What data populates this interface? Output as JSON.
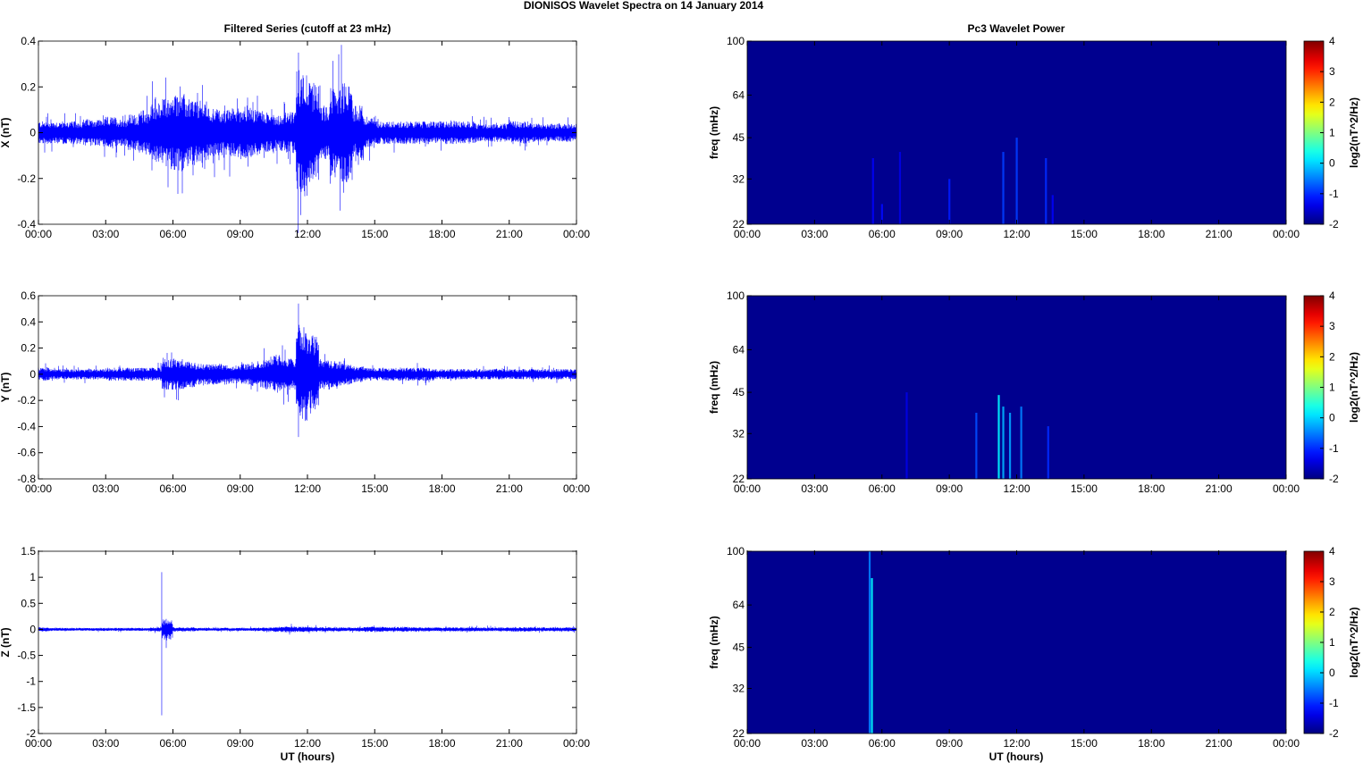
{
  "title": "DIONISOS Wavelet Spectra on 14 January   2014",
  "left_title": "Filtered Series (cutoff at 23 mHz)",
  "right_title": "Pc3 Wavelet Power",
  "xlabel": "UT (hours)",
  "xticks": [
    "00:00",
    "03:00",
    "06:00",
    "09:00",
    "12:00",
    "15:00",
    "18:00",
    "21:00",
    "00:00"
  ],
  "colors": {
    "trace": "#0000ff",
    "bg": "#00008f"
  },
  "chart_data": [
    {
      "type": "line",
      "component": "X",
      "ylabel": "X (nT)",
      "ylim": [
        -0.4,
        0.4
      ],
      "yticks": [
        "0.4",
        "0.2",
        "0",
        "-0.2",
        "-0.4"
      ],
      "ytick_values": [
        0.4,
        0.2,
        0,
        -0.2,
        -0.4
      ],
      "xlim_hours": [
        0,
        24
      ],
      "envelope_halfhourly": [
        0.05,
        0.05,
        0.05,
        0.05,
        0.06,
        0.06,
        0.07,
        0.06,
        0.08,
        0.1,
        0.13,
        0.15,
        0.17,
        0.15,
        0.14,
        0.11,
        0.1,
        0.11,
        0.12,
        0.1,
        0.09,
        0.08,
        0.09,
        0.28,
        0.22,
        0.12,
        0.2,
        0.22,
        0.12,
        0.07,
        0.05,
        0.05,
        0.05,
        0.05,
        0.05,
        0.05,
        0.05,
        0.05,
        0.05,
        0.04,
        0.04,
        0.04,
        0.05,
        0.05,
        0.04,
        0.04,
        0.04,
        0.04
      ],
      "extremes": {
        "max": 0.35,
        "max_time_h": 11.6,
        "min": -0.36,
        "min_time_h": 11.7
      }
    },
    {
      "type": "line",
      "component": "Y",
      "ylabel": "Y (nT)",
      "ylim": [
        -0.8,
        0.6
      ],
      "yticks": [
        "0.6",
        "0.4",
        "0.2",
        "0",
        "-0.2",
        "-0.4",
        "-0.6",
        "-0.8"
      ],
      "ytick_values": [
        0.6,
        0.4,
        0.2,
        0,
        -0.2,
        -0.4,
        -0.6,
        -0.8
      ],
      "xlim_hours": [
        0,
        24
      ],
      "envelope_halfhourly": [
        0.05,
        0.04,
        0.04,
        0.04,
        0.04,
        0.04,
        0.05,
        0.05,
        0.05,
        0.05,
        0.05,
        0.12,
        0.12,
        0.1,
        0.08,
        0.08,
        0.08,
        0.07,
        0.08,
        0.1,
        0.12,
        0.15,
        0.12,
        0.38,
        0.3,
        0.12,
        0.1,
        0.08,
        0.06,
        0.05,
        0.05,
        0.05,
        0.05,
        0.05,
        0.05,
        0.04,
        0.04,
        0.04,
        0.04,
        0.04,
        0.04,
        0.04,
        0.04,
        0.04,
        0.04,
        0.04,
        0.04,
        0.04
      ],
      "extremes": {
        "max": 0.54,
        "max_time_h": 11.6,
        "min": -0.48,
        "min_time_h": 11.6
      }
    },
    {
      "type": "line",
      "component": "Z",
      "ylabel": "Z (nT)",
      "ylim": [
        -2,
        1.5
      ],
      "yticks": [
        "1.5",
        "1",
        "0.5",
        "0",
        "-0.5",
        "-1",
        "-1.5",
        "-2"
      ],
      "ytick_values": [
        1.5,
        1,
        0.5,
        0,
        -0.5,
        -1,
        -1.5,
        -2
      ],
      "xlim_hours": [
        0,
        24
      ],
      "envelope_halfhourly": [
        0.04,
        0.03,
        0.03,
        0.03,
        0.03,
        0.03,
        0.03,
        0.03,
        0.03,
        0.03,
        0.04,
        0.2,
        0.04,
        0.04,
        0.03,
        0.03,
        0.03,
        0.03,
        0.03,
        0.03,
        0.04,
        0.05,
        0.06,
        0.05,
        0.05,
        0.04,
        0.04,
        0.04,
        0.04,
        0.05,
        0.05,
        0.04,
        0.05,
        0.04,
        0.04,
        0.04,
        0.04,
        0.04,
        0.04,
        0.04,
        0.04,
        0.04,
        0.04,
        0.04,
        0.04,
        0.04,
        0.04,
        0.04
      ],
      "extremes": {
        "max": 1.1,
        "max_time_h": 5.5,
        "min": -1.65,
        "min_time_h": 5.5
      }
    },
    {
      "type": "heatmap",
      "component": "X",
      "ylabel": "freq (mHz)",
      "yticks": [
        "100",
        "64",
        "45",
        "32",
        "22"
      ],
      "ytick_values": [
        100,
        64,
        45,
        32,
        22
      ],
      "ylim": [
        22,
        100
      ],
      "yscale": "log",
      "clim": [
        -2,
        4
      ],
      "colorbar_label": "log2(nT^2/Hz)",
      "cticks": [
        "4",
        "3",
        "2",
        "1",
        "0",
        "-1",
        "-2"
      ],
      "ctick_values": [
        4,
        3,
        2,
        1,
        0,
        -1,
        -2
      ],
      "bursts": [
        {
          "t": 5.6,
          "f": [
            22,
            38
          ],
          "p": -1.3
        },
        {
          "t": 6.0,
          "f": [
            22,
            26
          ],
          "p": -1.2
        },
        {
          "t": 6.8,
          "f": [
            22,
            40
          ],
          "p": -1.4
        },
        {
          "t": 9.0,
          "f": [
            22,
            32
          ],
          "p": -1.1
        },
        {
          "t": 11.4,
          "f": [
            22,
            40
          ],
          "p": -0.9
        },
        {
          "t": 12.0,
          "f": [
            22,
            45
          ],
          "p": -0.9
        },
        {
          "t": 13.3,
          "f": [
            22,
            38
          ],
          "p": -1.0
        },
        {
          "t": 13.6,
          "f": [
            22,
            28
          ],
          "p": -1.3
        }
      ]
    },
    {
      "type": "heatmap",
      "component": "Y",
      "ylabel": "freq (mHz)",
      "yticks": [
        "100",
        "64",
        "45",
        "32",
        "22"
      ],
      "ytick_values": [
        100,
        64,
        45,
        32,
        22
      ],
      "ylim": [
        22,
        100
      ],
      "yscale": "log",
      "clim": [
        -2,
        4
      ],
      "colorbar_label": "log2(nT^2/Hz)",
      "cticks": [
        "4",
        "3",
        "2",
        "1",
        "0",
        "-1",
        "-2"
      ],
      "ctick_values": [
        4,
        3,
        2,
        1,
        0,
        -1,
        -2
      ],
      "bursts": [
        {
          "t": 7.1,
          "f": [
            22,
            45
          ],
          "p": -1.4
        },
        {
          "t": 10.2,
          "f": [
            22,
            38
          ],
          "p": -0.8
        },
        {
          "t": 11.2,
          "f": [
            22,
            44
          ],
          "p": 0.2
        },
        {
          "t": 11.4,
          "f": [
            22,
            40
          ],
          "p": -0.2
        },
        {
          "t": 11.7,
          "f": [
            22,
            38
          ],
          "p": -0.3
        },
        {
          "t": 12.2,
          "f": [
            22,
            40
          ],
          "p": -0.5
        },
        {
          "t": 13.4,
          "f": [
            22,
            34
          ],
          "p": -1.0
        }
      ]
    },
    {
      "type": "heatmap",
      "component": "Z",
      "ylabel": "freq (mHz)",
      "yticks": [
        "100",
        "64",
        "45",
        "32",
        "22"
      ],
      "ytick_values": [
        100,
        64,
        45,
        32,
        22
      ],
      "ylim": [
        22,
        100
      ],
      "yscale": "log",
      "clim": [
        -2,
        4
      ],
      "colorbar_label": "log2(nT^2/Hz)",
      "cticks": [
        "4",
        "3",
        "2",
        "1",
        "0",
        "-1",
        "-2"
      ],
      "ctick_values": [
        4,
        3,
        2,
        1,
        0,
        -1,
        -2
      ],
      "bursts": [
        {
          "t": 5.45,
          "f": [
            22,
            100
          ],
          "p": -0.5
        },
        {
          "t": 5.55,
          "f": [
            22,
            80
          ],
          "p": 0.2
        }
      ]
    }
  ]
}
